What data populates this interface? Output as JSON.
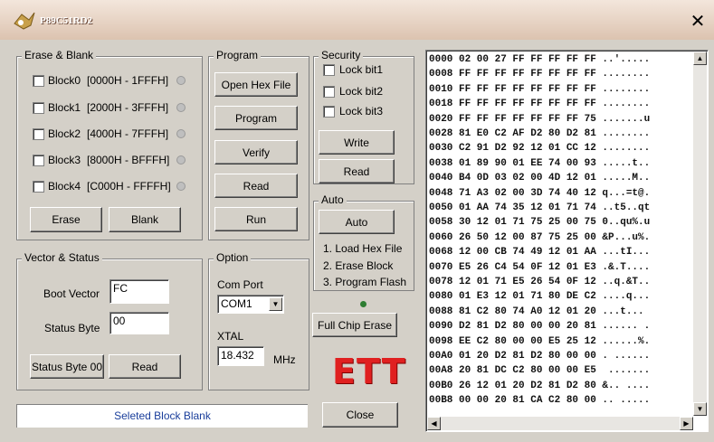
{
  "window": {
    "title": "P89C51RD2",
    "close_glyph": "✕"
  },
  "erase_blank": {
    "legend": "Erase & Blank",
    "blocks": [
      {
        "label": "Block0",
        "range": "[0000H - 1FFFH]"
      },
      {
        "label": "Block1",
        "range": "[2000H - 3FFFH]"
      },
      {
        "label": "Block2",
        "range": "[4000H - 7FFFH]"
      },
      {
        "label": "Block3",
        "range": "[8000H - BFFFH]"
      },
      {
        "label": "Block4",
        "range": "[C000H - FFFFH]"
      }
    ],
    "erase_label": "Erase",
    "blank_label": "Blank"
  },
  "program": {
    "legend": "Program",
    "open_hex_label": "Open Hex File",
    "program_label": "Program",
    "verify_label": "Verify",
    "read_label": "Read",
    "run_label": "Run"
  },
  "security": {
    "legend": "Security",
    "lock1": "Lock bit1",
    "lock2": "Lock bit2",
    "lock3": "Lock bit3",
    "write_label": "Write",
    "read_label": "Read"
  },
  "auto": {
    "legend": "Auto",
    "auto_label": "Auto",
    "steps": [
      "1. Load Hex File",
      "2. Erase Block",
      "3. Program Flash"
    ]
  },
  "vector_status": {
    "legend": "Vector & Status",
    "boot_vector_label": "Boot Vector",
    "boot_vector_value": "FC",
    "status_byte_label": "Status Byte",
    "status_byte_value": "00",
    "status_byte_00_label": "Status Byte 00",
    "read_label": "Read"
  },
  "option": {
    "legend": "Option",
    "com_port_label": "Com Port",
    "com_port_value": "COM1",
    "xtal_label": "XTAL",
    "xtal_value": "18.432",
    "xtal_unit": "MHz"
  },
  "full_chip_erase_label": "Full Chip Erase",
  "logo_text": "ETT",
  "close_label": "Close",
  "status_message": "Seleted Block Blank",
  "hex_lines": [
    "0000 02 00 27 FF FF FF FF FF ..'.....",
    "0008 FF FF FF FF FF FF FF FF ........",
    "0010 FF FF FF FF FF FF FF FF ........",
    "0018 FF FF FF FF FF FF FF FF ........",
    "0020 FF FF FF FF FF FF FF 75 .......u",
    "0028 81 E0 C2 AF D2 80 D2 81 ........",
    "0030 C2 91 D2 92 12 01 CC 12 ........",
    "0038 01 89 90 01 EE 74 00 93 .....t..",
    "0040 B4 0D 03 02 00 4D 12 01 .....M..",
    "0048 71 A3 02 00 3D 74 40 12 q...=t@.",
    "0050 01 AA 74 35 12 01 71 74 ..t5..qt",
    "0058 30 12 01 71 75 25 00 75 0..qu%.u",
    "0060 26 50 12 00 87 75 25 00 &P...u%.",
    "0068 12 00 CB 74 49 12 01 AA ...tI...",
    "0070 E5 26 C4 54 0F 12 01 E3 .&.T....",
    "0078 12 01 71 E5 26 54 0F 12 ..q.&T..",
    "0080 01 E3 12 01 71 80 DE C2 ....q...",
    "0088 81 C2 80 74 A0 12 01 20 ...t... ",
    "0090 D2 81 D2 80 00 00 20 81 ...... .",
    "0098 EE C2 80 00 00 E5 25 12 ......%.",
    "00A0 01 20 D2 81 D2 80 00 00 . ......",
    "00A8 20 81 DC C2 80 00 00 E5  .......",
    "00B0 26 12 01 20 D2 81 D2 80 &.. ....",
    "00B8 00 00 20 81 CA C2 80 00 .. ....."
  ],
  "icons": {
    "app": "app-icon",
    "close": "close-icon",
    "scroll_up": "scroll-up-arrow-icon",
    "scroll_down": "scroll-down-arrow-icon",
    "scroll_left": "scroll-left-arrow-icon",
    "scroll_right": "scroll-right-arrow-icon",
    "dropdown": "dropdown-arrow-icon"
  },
  "colors": {
    "status_text": "#1a3e9b",
    "logo": "#e02020",
    "led": "#2e7d32"
  }
}
